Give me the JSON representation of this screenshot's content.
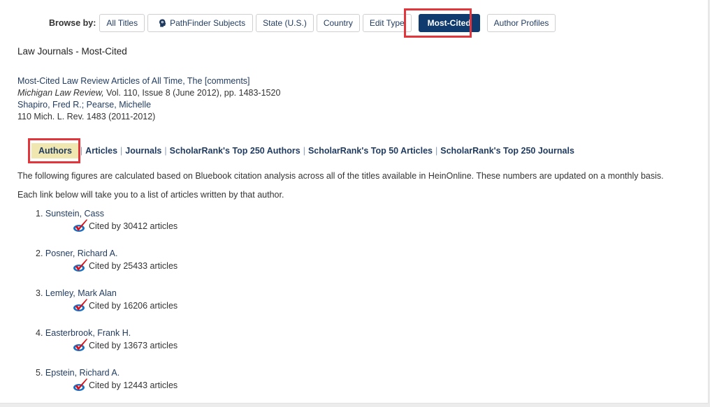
{
  "browse": {
    "label": "Browse by:",
    "buttons": [
      {
        "label": "All Titles",
        "active": false
      },
      {
        "label": "PathFinder Subjects",
        "active": false,
        "icon": "head-brain-icon"
      },
      {
        "label": "State (U.S.)",
        "active": false
      },
      {
        "label": "Country",
        "active": false
      },
      {
        "label": "Edit Type",
        "active": false
      },
      {
        "label": "Most-Cited",
        "active": true
      },
      {
        "label": "Author Profiles",
        "active": false
      }
    ]
  },
  "page_title": "Law Journals - Most-Cited",
  "citation": {
    "article_title": "Most-Cited Law Review Articles of All Time, The [comments]",
    "journal": "Michigan Law Review,",
    "journal_details": " Vol. 110, Issue 8 (June 2012), pp. 1483-1520",
    "authors": "Shapiro, Fred R.; Pearse, Michelle",
    "reference": "110 Mich. L. Rev. 1483 (2011-2012)"
  },
  "tabs": [
    {
      "label": "Authors",
      "active": true
    },
    {
      "label": "Articles",
      "active": false
    },
    {
      "label": "Journals",
      "active": false
    },
    {
      "label": "ScholarRank's Top 250 Authors",
      "active": false
    },
    {
      "label": "ScholarRank's Top 50 Articles",
      "active": false
    },
    {
      "label": "ScholarRank's Top 250 Journals",
      "active": false
    }
  ],
  "description": "The following figures are calculated based on Bluebook citation analysis across all of the titles available in HeinOnline. These numbers are updated on a monthly basis.",
  "instruction": "Each link below will take you to a list of articles written by that author.",
  "authors": [
    {
      "rank": "1.",
      "name": "Sunstein, Cass",
      "cited": "Cited by 30412 articles"
    },
    {
      "rank": "2.",
      "name": "Posner, Richard A.",
      "cited": "Cited by 25433 articles"
    },
    {
      "rank": "3.",
      "name": "Lemley, Mark Alan",
      "cited": "Cited by 16206 articles"
    },
    {
      "rank": "4.",
      "name": "Easterbrook, Frank H.",
      "cited": "Cited by 13673 articles"
    },
    {
      "rank": "5.",
      "name": "Epstein, Richard A.",
      "cited": "Cited by 12443 articles"
    }
  ],
  "colors": {
    "link": "#1f3a5f",
    "active_button": "#0f3b6e",
    "highlight_border": "#e0363c",
    "active_tab_bg": "#efe6b0"
  }
}
